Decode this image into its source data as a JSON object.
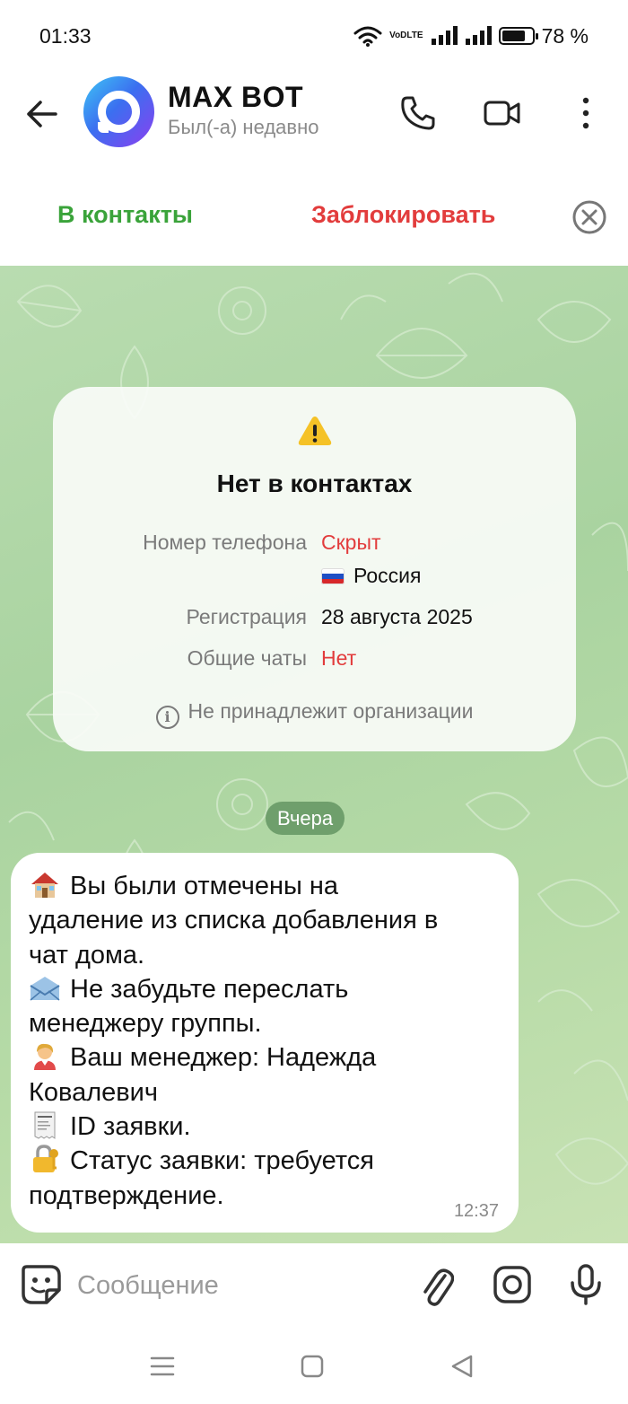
{
  "status_bar": {
    "time": "01:33",
    "volte_line1": "VoD",
    "volte_line2": "LTE",
    "battery_percent_label": "78 %",
    "battery_level": 0.78
  },
  "header": {
    "title": "MAX BOT",
    "subtitle": "Был(-а) недавно",
    "icons": [
      "back-arrow-icon",
      "phone-icon",
      "video-camera-icon",
      "more-vertical-icon"
    ]
  },
  "actions": {
    "add_contact": "В контакты",
    "block": "Заблокировать",
    "colors": {
      "add": "#3aa33a",
      "block": "#e23c3c"
    }
  },
  "info_card": {
    "title": "Нет в контактах",
    "rows": [
      {
        "label": "Номер телефона",
        "value": "Скрыт",
        "value2": "Россия"
      },
      {
        "label": "Регистрация",
        "value": "28 августа 2025"
      },
      {
        "label": "Общие чаты",
        "value": "Нет"
      }
    ],
    "org_note": "Не принадлежит организации"
  },
  "date_divider": "Вчера",
  "message": {
    "lines": [
      "Вы были отмечены на",
      "удаление из списка добавления в",
      "чат дома.",
      "Не забудьте переслать",
      "менеджеру группы.",
      "Ваш менеджер: Надежда",
      "Ковалевич",
      "ID заявки.",
      "Статус заявки: требуется",
      "подтверждение."
    ],
    "emoji_icons": [
      "house-icon",
      "envelope-icon",
      "office-worker-icon",
      "receipt-icon",
      "lock-key-icon"
    ],
    "time": "12:37"
  },
  "composer": {
    "placeholder": "Сообщение",
    "icons": [
      "sticker-icon",
      "paperclip-icon",
      "camera-icon",
      "microphone-icon"
    ]
  }
}
